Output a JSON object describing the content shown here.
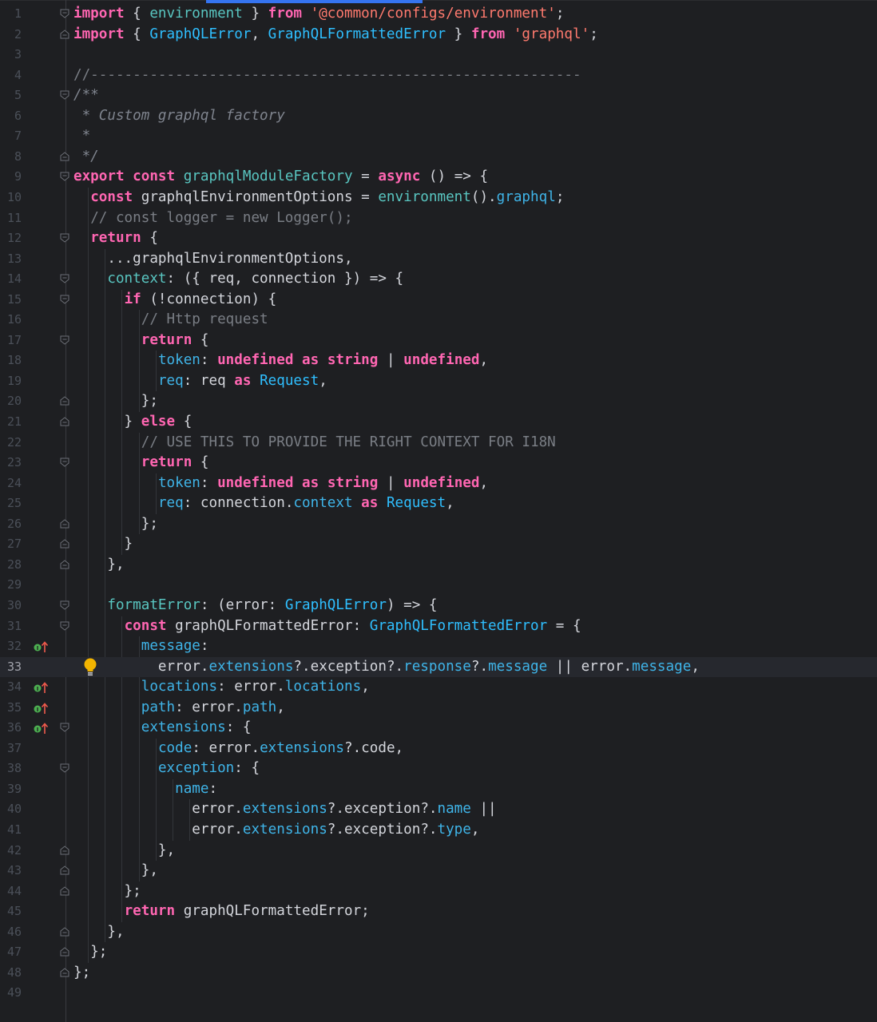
{
  "editor": {
    "current_line": 33,
    "lines": [
      {
        "n": "1",
        "fold": "open",
        "tokens": [
          [
            "kw",
            "import"
          ],
          [
            "pl",
            " { "
          ],
          [
            "id",
            "environment"
          ],
          [
            "pl",
            " } "
          ],
          [
            "kw",
            "from"
          ],
          [
            "pl",
            " "
          ],
          [
            "str",
            "'@common/configs/environment'"
          ],
          [
            "pl",
            ";"
          ]
        ]
      },
      {
        "n": "2",
        "fold": "close",
        "tokens": [
          [
            "kw",
            "import"
          ],
          [
            "pl",
            " { "
          ],
          [
            "ty",
            "GraphQLError"
          ],
          [
            "pl",
            ", "
          ],
          [
            "ty",
            "GraphQLFormattedError"
          ],
          [
            "pl",
            " } "
          ],
          [
            "kw",
            "from"
          ],
          [
            "pl",
            " "
          ],
          [
            "str",
            "'graphql'"
          ],
          [
            "pl",
            ";"
          ]
        ]
      },
      {
        "n": "3",
        "tokens": []
      },
      {
        "n": "4",
        "tokens": [
          [
            "cm",
            "//----------------------------------------------------------"
          ]
        ]
      },
      {
        "n": "5",
        "fold": "open",
        "tokens": [
          [
            "doc",
            "/**"
          ]
        ]
      },
      {
        "n": "6",
        "tokens": [
          [
            "doc",
            " * Custom graphql factory"
          ]
        ]
      },
      {
        "n": "7",
        "tokens": [
          [
            "doc",
            " *"
          ]
        ]
      },
      {
        "n": "8",
        "fold": "close",
        "tokens": [
          [
            "doc",
            " */"
          ]
        ]
      },
      {
        "n": "9",
        "fold": "open",
        "tokens": [
          [
            "kw",
            "export"
          ],
          [
            "pl",
            " "
          ],
          [
            "kw",
            "const"
          ],
          [
            "pl",
            " "
          ],
          [
            "id",
            "graphqlModuleFactory"
          ],
          [
            "pl",
            " = "
          ],
          [
            "kw",
            "async"
          ],
          [
            "pl",
            " () => {"
          ]
        ]
      },
      {
        "n": "10",
        "tokens": [
          [
            "pl",
            "  "
          ],
          [
            "kw",
            "const"
          ],
          [
            "pl",
            " graphqlEnvironmentOptions = "
          ],
          [
            "id",
            "environment"
          ],
          [
            "pl",
            "()."
          ],
          [
            "pr",
            "graphql"
          ],
          [
            "pl",
            ";"
          ]
        ]
      },
      {
        "n": "11",
        "tokens": [
          [
            "pl",
            "  "
          ],
          [
            "cm",
            "// const logger = new Logger();"
          ]
        ]
      },
      {
        "n": "12",
        "fold": "open",
        "tokens": [
          [
            "pl",
            "  "
          ],
          [
            "kw",
            "return"
          ],
          [
            "pl",
            " {"
          ]
        ]
      },
      {
        "n": "13",
        "tokens": [
          [
            "pl",
            "    ...graphqlEnvironmentOptions,"
          ]
        ]
      },
      {
        "n": "14",
        "fold": "open",
        "tokens": [
          [
            "pl",
            "    "
          ],
          [
            "id",
            "context"
          ],
          [
            "pl",
            ": ({ req, connection }) => {"
          ]
        ]
      },
      {
        "n": "15",
        "fold": "open",
        "tokens": [
          [
            "pl",
            "      "
          ],
          [
            "kw",
            "if"
          ],
          [
            "pl",
            " (!connection) {"
          ]
        ]
      },
      {
        "n": "16",
        "tokens": [
          [
            "pl",
            "        "
          ],
          [
            "cm",
            "// Http request"
          ]
        ]
      },
      {
        "n": "17",
        "fold": "open",
        "tokens": [
          [
            "pl",
            "        "
          ],
          [
            "kw",
            "return"
          ],
          [
            "pl",
            " {"
          ]
        ]
      },
      {
        "n": "18",
        "tokens": [
          [
            "pl",
            "          "
          ],
          [
            "pr",
            "token"
          ],
          [
            "pl",
            ": "
          ],
          [
            "kw",
            "undefined"
          ],
          [
            "pl",
            " "
          ],
          [
            "kw",
            "as"
          ],
          [
            "pl",
            " "
          ],
          [
            "kw",
            "string"
          ],
          [
            "pl",
            " | "
          ],
          [
            "kw",
            "undefined"
          ],
          [
            "pl",
            ","
          ]
        ]
      },
      {
        "n": "19",
        "tokens": [
          [
            "pl",
            "          "
          ],
          [
            "pr",
            "req"
          ],
          [
            "pl",
            ": req "
          ],
          [
            "kw",
            "as"
          ],
          [
            "pl",
            " "
          ],
          [
            "ty",
            "Request"
          ],
          [
            "pl",
            ","
          ]
        ]
      },
      {
        "n": "20",
        "fold": "close",
        "tokens": [
          [
            "pl",
            "        };"
          ]
        ]
      },
      {
        "n": "21",
        "fold": "close",
        "tokens": [
          [
            "pl",
            "      } "
          ],
          [
            "kw",
            "else"
          ],
          [
            "pl",
            " {"
          ]
        ]
      },
      {
        "n": "22",
        "tokens": [
          [
            "pl",
            "        "
          ],
          [
            "cm",
            "// USE THIS TO PROVIDE THE RIGHT CONTEXT FOR I18N"
          ]
        ]
      },
      {
        "n": "23",
        "fold": "open",
        "tokens": [
          [
            "pl",
            "        "
          ],
          [
            "kw",
            "return"
          ],
          [
            "pl",
            " {"
          ]
        ]
      },
      {
        "n": "24",
        "tokens": [
          [
            "pl",
            "          "
          ],
          [
            "pr",
            "token"
          ],
          [
            "pl",
            ": "
          ],
          [
            "kw",
            "undefined"
          ],
          [
            "pl",
            " "
          ],
          [
            "kw",
            "as"
          ],
          [
            "pl",
            " "
          ],
          [
            "kw",
            "string"
          ],
          [
            "pl",
            " | "
          ],
          [
            "kw",
            "undefined"
          ],
          [
            "pl",
            ","
          ]
        ]
      },
      {
        "n": "25",
        "tokens": [
          [
            "pl",
            "          "
          ],
          [
            "pr",
            "req"
          ],
          [
            "pl",
            ": connection."
          ],
          [
            "pr",
            "context"
          ],
          [
            "pl",
            " "
          ],
          [
            "kw",
            "as"
          ],
          [
            "pl",
            " "
          ],
          [
            "ty",
            "Request"
          ],
          [
            "pl",
            ","
          ]
        ]
      },
      {
        "n": "26",
        "fold": "close",
        "tokens": [
          [
            "pl",
            "        };"
          ]
        ]
      },
      {
        "n": "27",
        "fold": "close",
        "tokens": [
          [
            "pl",
            "      }"
          ]
        ]
      },
      {
        "n": "28",
        "fold": "close",
        "tokens": [
          [
            "pl",
            "    },"
          ]
        ]
      },
      {
        "n": "29",
        "tokens": []
      },
      {
        "n": "30",
        "fold": "open",
        "tokens": [
          [
            "pl",
            "    "
          ],
          [
            "id",
            "formatError"
          ],
          [
            "pl",
            ": (error: "
          ],
          [
            "ty",
            "GraphQLError"
          ],
          [
            "pl",
            ") => {"
          ]
        ]
      },
      {
        "n": "31",
        "fold": "open",
        "tokens": [
          [
            "pl",
            "      "
          ],
          [
            "kw",
            "const"
          ],
          [
            "pl",
            " graphQLFormattedError: "
          ],
          [
            "ty",
            "GraphQLFormattedError"
          ],
          [
            "pl",
            " = {"
          ]
        ]
      },
      {
        "n": "32",
        "mark": true,
        "tokens": [
          [
            "pl",
            "        "
          ],
          [
            "pr",
            "message"
          ],
          [
            "pl",
            ":"
          ]
        ]
      },
      {
        "n": "33",
        "bulb": true,
        "tokens": [
          [
            "pl",
            "          error."
          ],
          [
            "pr",
            "extensions"
          ],
          [
            "pl",
            "?.exception?."
          ],
          [
            "pr",
            "response"
          ],
          [
            "pl",
            "?."
          ],
          [
            "pr",
            "message"
          ],
          [
            "pl",
            " || error."
          ],
          [
            "pr",
            "message"
          ],
          [
            "pl",
            ","
          ]
        ]
      },
      {
        "n": "34",
        "mark": true,
        "tokens": [
          [
            "pl",
            "        "
          ],
          [
            "pr",
            "locations"
          ],
          [
            "pl",
            ": error."
          ],
          [
            "pr",
            "locations"
          ],
          [
            "pl",
            ","
          ]
        ]
      },
      {
        "n": "35",
        "mark": true,
        "tokens": [
          [
            "pl",
            "        "
          ],
          [
            "pr",
            "path"
          ],
          [
            "pl",
            ": error."
          ],
          [
            "pr",
            "path"
          ],
          [
            "pl",
            ","
          ]
        ]
      },
      {
        "n": "36",
        "mark": true,
        "fold": "open",
        "tokens": [
          [
            "pl",
            "        "
          ],
          [
            "pr",
            "extensions"
          ],
          [
            "pl",
            ": {"
          ]
        ]
      },
      {
        "n": "37",
        "tokens": [
          [
            "pl",
            "          "
          ],
          [
            "pr",
            "code"
          ],
          [
            "pl",
            ": error."
          ],
          [
            "pr",
            "extensions"
          ],
          [
            "pl",
            "?.code,"
          ]
        ]
      },
      {
        "n": "38",
        "fold": "open",
        "tokens": [
          [
            "pl",
            "          "
          ],
          [
            "pr",
            "exception"
          ],
          [
            "pl",
            ": {"
          ]
        ]
      },
      {
        "n": "39",
        "tokens": [
          [
            "pl",
            "            "
          ],
          [
            "pr",
            "name"
          ],
          [
            "pl",
            ":"
          ]
        ]
      },
      {
        "n": "40",
        "tokens": [
          [
            "pl",
            "              error."
          ],
          [
            "pr",
            "extensions"
          ],
          [
            "pl",
            "?.exception?."
          ],
          [
            "pr",
            "name"
          ],
          [
            "pl",
            " ||"
          ]
        ]
      },
      {
        "n": "41",
        "tokens": [
          [
            "pl",
            "              error."
          ],
          [
            "pr",
            "extensions"
          ],
          [
            "pl",
            "?.exception?."
          ],
          [
            "pr",
            "type"
          ],
          [
            "pl",
            ","
          ]
        ]
      },
      {
        "n": "42",
        "fold": "close",
        "tokens": [
          [
            "pl",
            "          },"
          ]
        ]
      },
      {
        "n": "43",
        "fold": "close",
        "tokens": [
          [
            "pl",
            "        },"
          ]
        ]
      },
      {
        "n": "44",
        "fold": "close",
        "tokens": [
          [
            "pl",
            "      };"
          ]
        ]
      },
      {
        "n": "45",
        "tokens": [
          [
            "pl",
            "      "
          ],
          [
            "kw",
            "return"
          ],
          [
            "pl",
            " graphQLFormattedError;"
          ]
        ]
      },
      {
        "n": "46",
        "fold": "close",
        "tokens": [
          [
            "pl",
            "    },"
          ]
        ]
      },
      {
        "n": "47",
        "fold": "close",
        "tokens": [
          [
            "pl",
            "  };"
          ]
        ]
      },
      {
        "n": "48",
        "fold": "close",
        "tokens": [
          [
            "pl",
            "};"
          ]
        ]
      },
      {
        "n": "49",
        "tokens": []
      }
    ]
  }
}
